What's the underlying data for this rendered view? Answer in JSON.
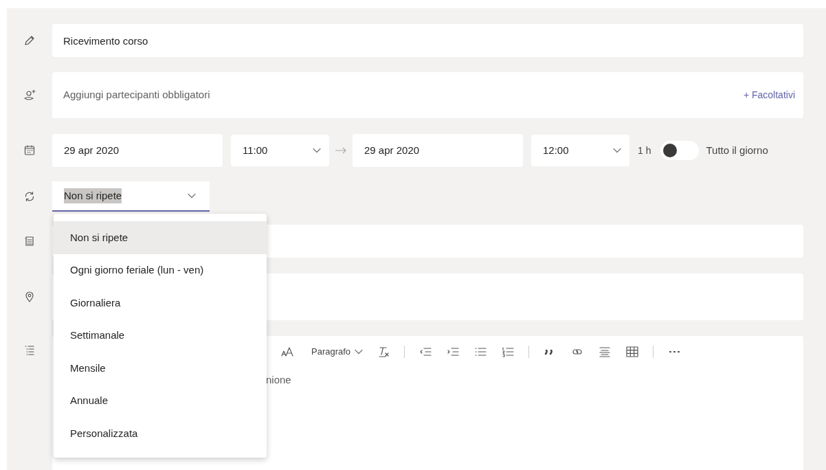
{
  "title_field": {
    "value": "Ricevimento corso"
  },
  "participants_field": {
    "placeholder": "Aggiungi partecipanti obbligatori",
    "optional_link": "+ Facoltativi"
  },
  "schedule": {
    "start_date": "29 apr 2020",
    "start_time": "11:00",
    "end_date": "29 apr 2020",
    "end_time": "12:00",
    "duration": "1 h",
    "all_day": {
      "label": "Tutto il giorno",
      "on": false
    }
  },
  "repeat": {
    "value": "Non si ripete",
    "expanded": true,
    "options": [
      {
        "label": "Non si ripete",
        "selected": true
      },
      {
        "label": "Ogni giorno feriale (lun - ven)",
        "selected": false
      },
      {
        "label": "Giornaliera",
        "selected": false
      },
      {
        "label": "Settimanale",
        "selected": false
      },
      {
        "label": "Mensile",
        "selected": false
      },
      {
        "label": "Annuale",
        "selected": false
      },
      {
        "label": "Personalizzata",
        "selected": false
      }
    ]
  },
  "editor": {
    "paragraph_menu": "Paragrafo",
    "placeholder": "nione"
  }
}
